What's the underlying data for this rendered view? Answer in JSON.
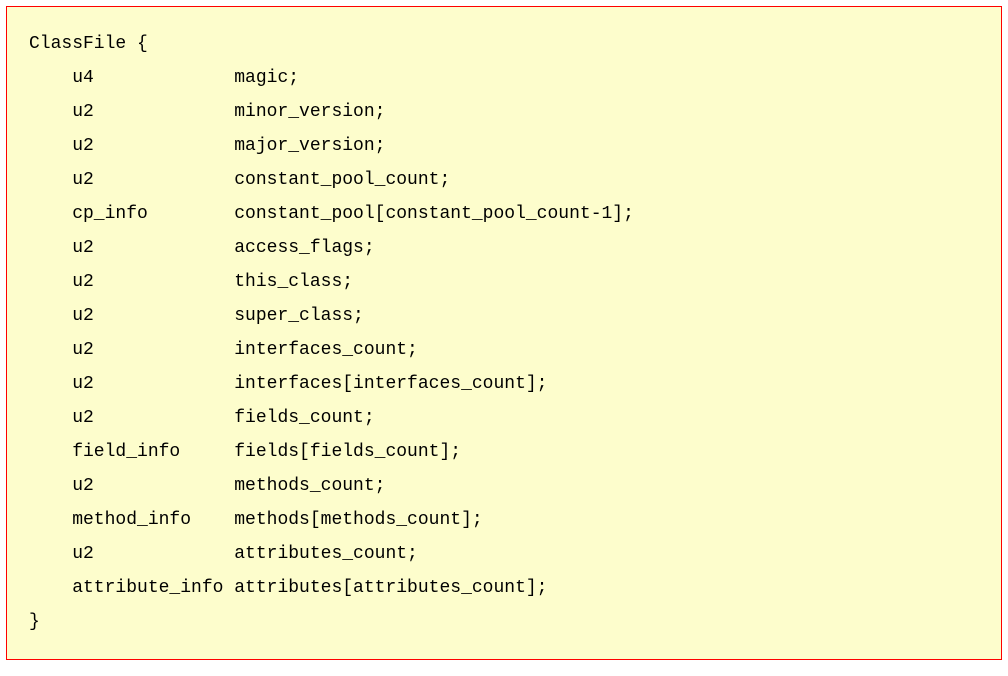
{
  "struct": {
    "open": "ClassFile {",
    "close": "}",
    "fields": [
      {
        "type": "u4",
        "name": "magic;"
      },
      {
        "type": "u2",
        "name": "minor_version;"
      },
      {
        "type": "u2",
        "name": "major_version;"
      },
      {
        "type": "u2",
        "name": "constant_pool_count;"
      },
      {
        "type": "cp_info",
        "name": "constant_pool[constant_pool_count-1];"
      },
      {
        "type": "u2",
        "name": "access_flags;"
      },
      {
        "type": "u2",
        "name": "this_class;"
      },
      {
        "type": "u2",
        "name": "super_class;"
      },
      {
        "type": "u2",
        "name": "interfaces_count;"
      },
      {
        "type": "u2",
        "name": "interfaces[interfaces_count];"
      },
      {
        "type": "u2",
        "name": "fields_count;"
      },
      {
        "type": "field_info",
        "name": "fields[fields_count];"
      },
      {
        "type": "u2",
        "name": "methods_count;"
      },
      {
        "type": "method_info",
        "name": "methods[methods_count];"
      },
      {
        "type": "u2",
        "name": "attributes_count;"
      },
      {
        "type": "attribute_info",
        "name": "attributes[attributes_count];"
      }
    ]
  },
  "layout": {
    "indent": "    ",
    "typeColWidth": 15
  }
}
